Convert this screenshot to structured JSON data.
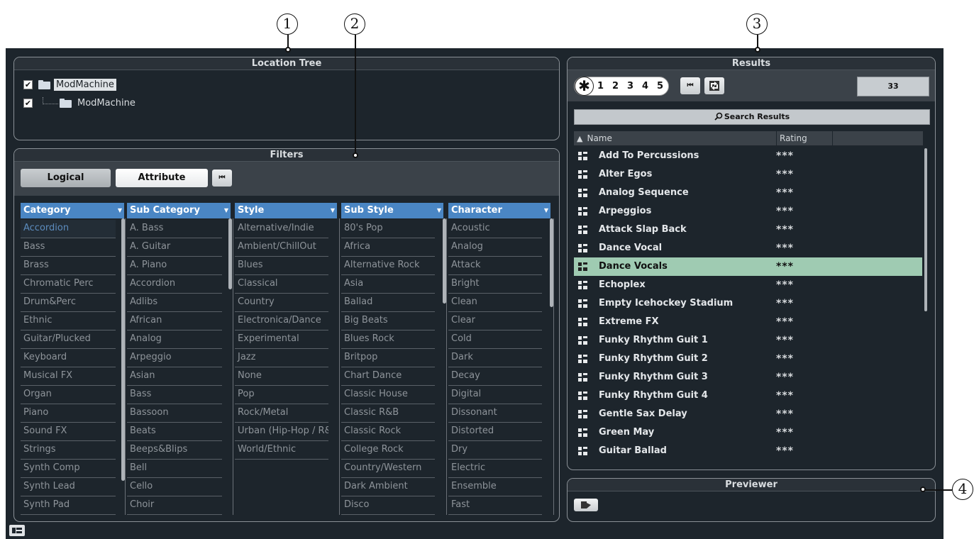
{
  "callouts": [
    "1",
    "2",
    "3",
    "4"
  ],
  "location_tree": {
    "title": "Location Tree",
    "items": [
      {
        "label": "ModMachine",
        "checked": "✔"
      },
      {
        "label": "ModMachine",
        "checked": "✔"
      }
    ]
  },
  "filters": {
    "title": "Filters",
    "logical_label": "Logical",
    "attribute_label": "Attribute",
    "reset_icon": "⏮",
    "columns": [
      {
        "header": "Category",
        "items": [
          "Accordion",
          "Bass",
          "Brass",
          "Chromatic Perc",
          "Drum&Perc",
          "Ethnic",
          "Guitar/Plucked",
          "Keyboard",
          "Musical FX",
          "Organ",
          "Piano",
          "Sound FX",
          "Strings",
          "Synth Comp",
          "Synth Lead",
          "Synth Pad"
        ]
      },
      {
        "header": "Sub Category",
        "items": [
          "A. Bass",
          "A. Guitar",
          "A. Piano",
          "Accordion",
          "Adlibs",
          "African",
          "Analog",
          "Arpeggio",
          "Asian",
          "Bass",
          "Bassoon",
          "Beats",
          "Beeps&Blips",
          "Bell",
          "Cello",
          "Choir"
        ]
      },
      {
        "header": "Style",
        "items": [
          "Alternative/Indie",
          "Ambient/ChillOut",
          "Blues",
          "Classical",
          "Country",
          "Electronica/Dance",
          "Experimental",
          "Jazz",
          "None",
          "Pop",
          "Rock/Metal",
          "Urban (Hip-Hop / R&B)",
          "World/Ethnic"
        ]
      },
      {
        "header": "Sub Style",
        "items": [
          "80's Pop",
          "Africa",
          "Alternative Rock",
          "Asia",
          "Ballad",
          "Big Beats",
          "Blues Rock",
          "Britpop",
          "Chart Dance",
          "Classic House",
          "Classic R&B",
          "Classic Rock",
          "College Rock",
          "Country/Western",
          "Dark Ambient",
          "Disco"
        ]
      },
      {
        "header": "Character",
        "items": [
          "Acoustic",
          "Analog",
          "Attack",
          "Bright",
          "Clean",
          "Clear",
          "Cold",
          "Dark",
          "Decay",
          "Digital",
          "Dissonant",
          "Distorted",
          "Dry",
          "Electric",
          "Ensemble",
          "Fast"
        ]
      }
    ]
  },
  "results": {
    "title": "Results",
    "star": "✱",
    "rating_slots": [
      "1",
      "2",
      "3",
      "4",
      "5"
    ],
    "count": "33",
    "search_label": "Search Results",
    "col_name": "Name",
    "col_rating": "Rating",
    "sort_icon": "▲",
    "rows": [
      {
        "name": "Add To Percussions",
        "rating": "***"
      },
      {
        "name": "Alter Egos",
        "rating": "***"
      },
      {
        "name": "Analog Sequence",
        "rating": "***"
      },
      {
        "name": "Arpeggios",
        "rating": "***"
      },
      {
        "name": "Attack Slap Back",
        "rating": "***"
      },
      {
        "name": "Dance Vocal",
        "rating": "***"
      },
      {
        "name": "Dance Vocals",
        "rating": "***"
      },
      {
        "name": "Echoplex",
        "rating": "***"
      },
      {
        "name": "Empty Icehockey Stadium",
        "rating": "***"
      },
      {
        "name": "Extreme FX",
        "rating": "***"
      },
      {
        "name": "Funky Rhythm Guit 1",
        "rating": "***"
      },
      {
        "name": "Funky Rhythm Guit 2",
        "rating": "***"
      },
      {
        "name": "Funky Rhythm Guit 3",
        "rating": "***"
      },
      {
        "name": "Funky Rhythm Guit 4",
        "rating": "***"
      },
      {
        "name": "Gentle Sax Delay",
        "rating": "***"
      },
      {
        "name": "Green May",
        "rating": "***"
      },
      {
        "name": "Guitar Ballad",
        "rating": "***"
      }
    ]
  },
  "previewer": {
    "title": "Previewer"
  }
}
